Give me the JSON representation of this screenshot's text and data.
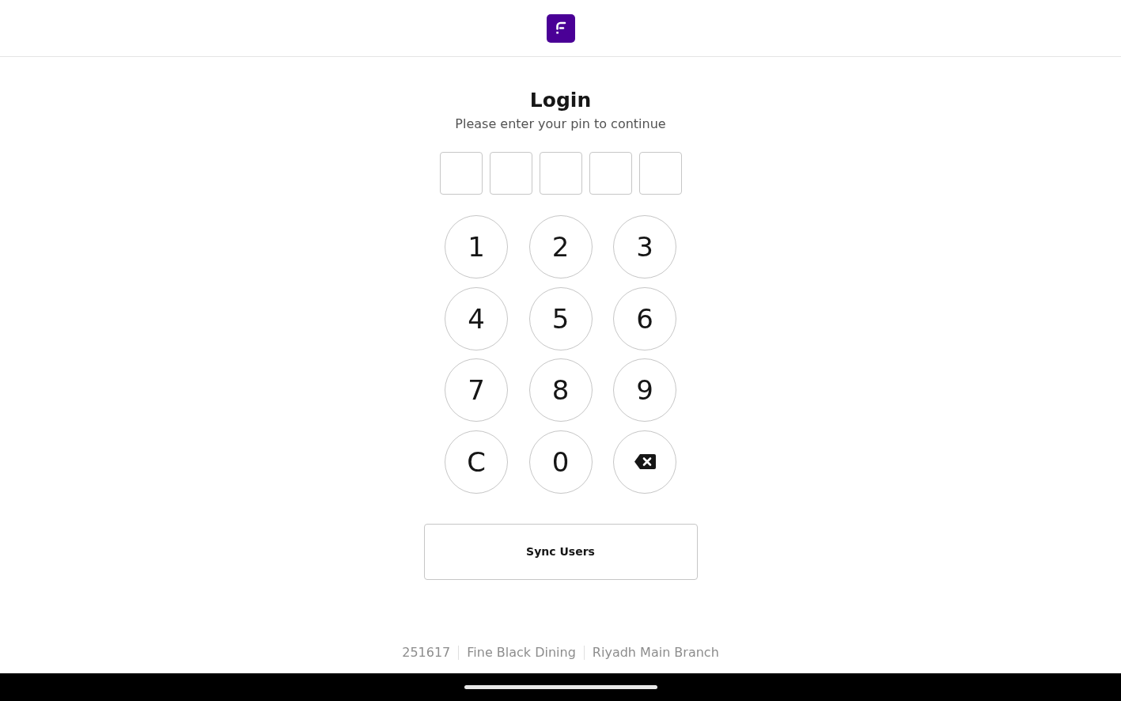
{
  "title": "Login",
  "subtitle": "Please enter your pin to continue",
  "pin_slots": [
    {
      "filled": false
    },
    {
      "filled": false
    },
    {
      "filled": false
    },
    {
      "filled": false
    },
    {
      "filled": false
    }
  ],
  "keypad": [
    {
      "kind": "digit",
      "label": "1"
    },
    {
      "kind": "digit",
      "label": "2"
    },
    {
      "kind": "digit",
      "label": "3"
    },
    {
      "kind": "digit",
      "label": "4"
    },
    {
      "kind": "digit",
      "label": "5"
    },
    {
      "kind": "digit",
      "label": "6"
    },
    {
      "kind": "digit",
      "label": "7"
    },
    {
      "kind": "digit",
      "label": "8"
    },
    {
      "kind": "digit",
      "label": "9"
    },
    {
      "kind": "digit",
      "label": "C"
    },
    {
      "kind": "digit",
      "label": "0"
    },
    {
      "kind": "backspace"
    }
  ],
  "sync_button": "Sync Users",
  "footer": [
    "251617",
    "Fine Black Dining",
    "Riyadh Main Branch"
  ]
}
